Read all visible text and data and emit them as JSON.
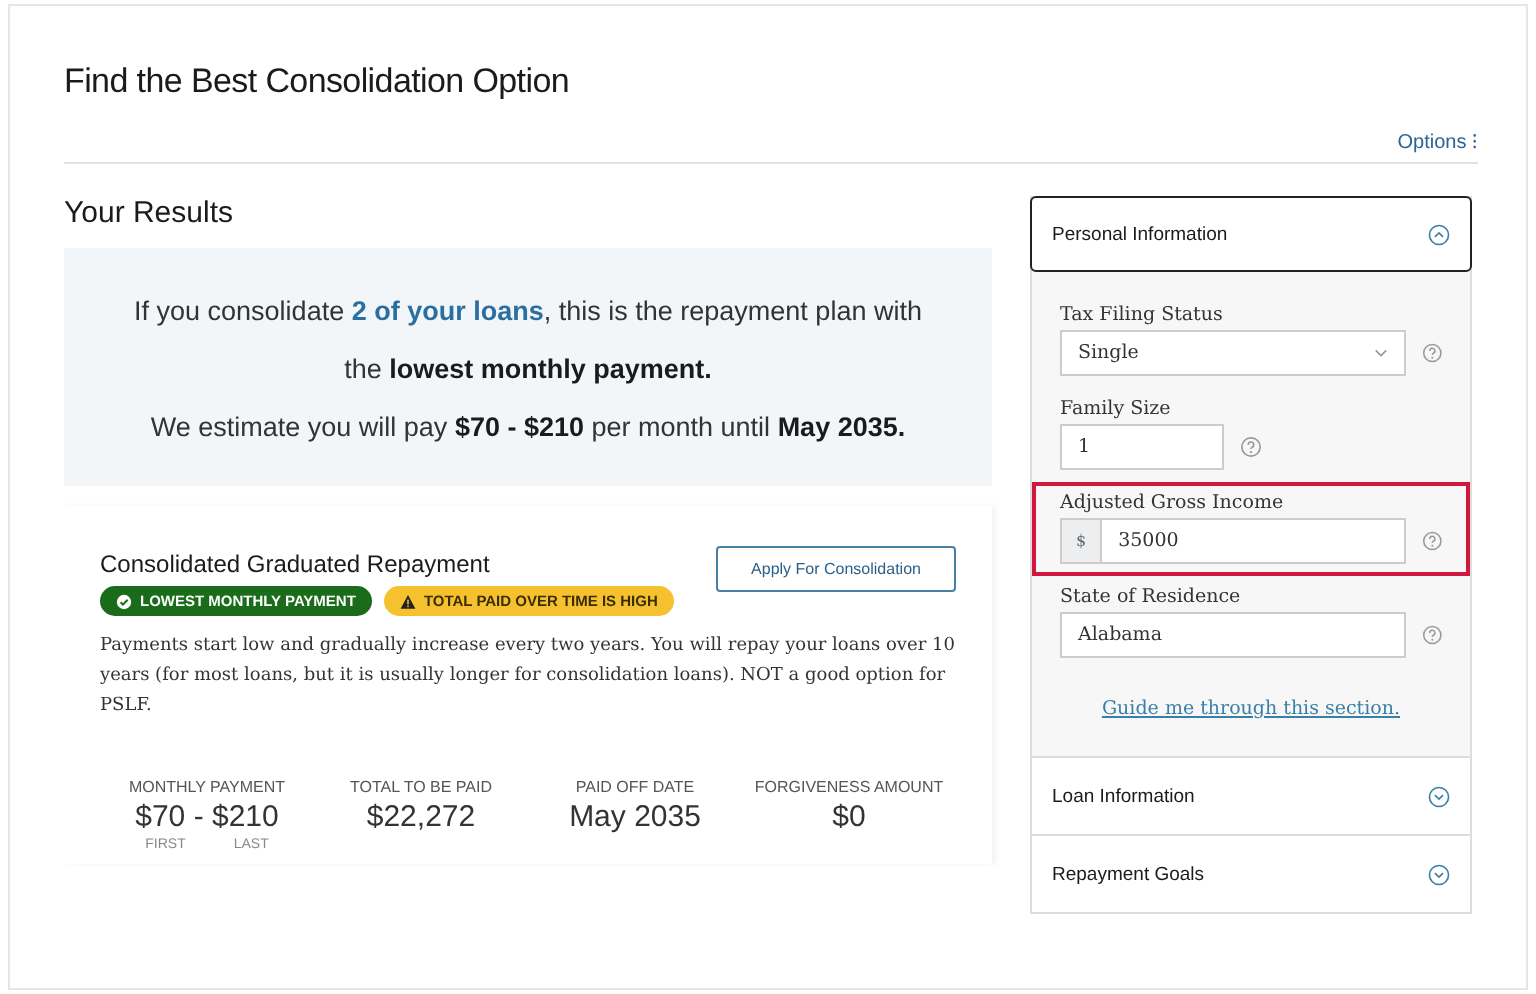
{
  "page_title": "Find the Best Consolidation Option",
  "options_link": "Options ⁝",
  "results": {
    "heading": "Your Results",
    "summary": {
      "line_1": {
        "before": "If you consolidate ",
        "link": "2 of your loans",
        "after": ", this is the repayment plan with"
      },
      "line_2": "the **lowest monthly payment.**",
      "line_3": "We estimate you will pay **$70 - $210** per month until **May 2035.**"
    },
    "plan": {
      "name": "Consolidated Graduated Repayment",
      "button": "Apply For Consolidation",
      "badges": [
        {
          "kind": "success",
          "label": "LOWEST MONTHLY PAYMENT"
        },
        {
          "kind": "warning",
          "label": "TOTAL PAID OVER TIME IS HIGH"
        }
      ],
      "description": "Payments start low and gradually increase every two years. You will repay your loans over 10 years (for most loans, but it is usually longer for consolidation loans). NOT a good option for PSLF.",
      "stats": [
        {
          "label": "MONTHLY PAYMENT",
          "value": "$70 - $210",
          "sublabels": [
            "FIRST",
            "LAST"
          ]
        },
        {
          "label": "TOTAL TO BE PAID",
          "value": "$22,272"
        },
        {
          "label": "PAID OFF DATE",
          "value": "May 2035"
        },
        {
          "label": "FORGIVENESS AMOUNT",
          "value": "$0"
        }
      ]
    }
  },
  "sidebar": {
    "sections": [
      {
        "title": "Personal Information",
        "expanded": true,
        "fields": [
          {
            "kind": "select",
            "label": "Tax Filing Status",
            "value": "Single",
            "highlighted": false
          },
          {
            "kind": "text",
            "label": "Family Size",
            "value": "1",
            "highlighted": false
          },
          {
            "kind": "currency",
            "label": "Adjusted Gross Income",
            "prefix": "$",
            "value": "35000",
            "highlighted": true
          },
          {
            "kind": "text",
            "label": "State of Residence",
            "value": "Alabama",
            "highlighted": false
          }
        ],
        "guide_link": "Guide me through this section."
      },
      {
        "title": "Loan Information",
        "expanded": false
      },
      {
        "title": "Repayment Goals",
        "expanded": false
      }
    ]
  }
}
